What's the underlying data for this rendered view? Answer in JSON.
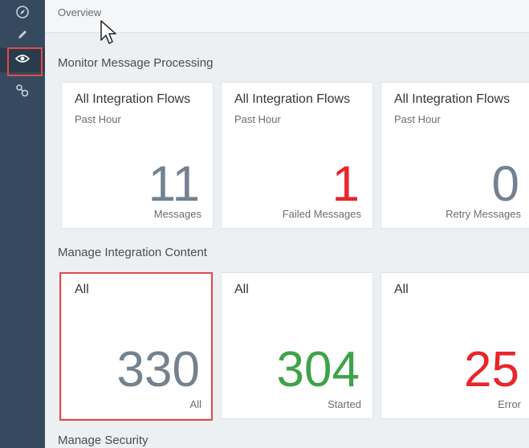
{
  "topbar": {
    "title": "Overview"
  },
  "sections": {
    "monitor": "Monitor Message Processing",
    "manage_content": "Manage Integration Content",
    "manage_security": "Manage Security"
  },
  "monitor_tiles": [
    {
      "title": "All Integration Flows",
      "subtitle": "Past Hour",
      "value": "11",
      "unit": "Messages",
      "color": "#73828e"
    },
    {
      "title": "All Integration Flows",
      "subtitle": "Past Hour",
      "value": "1",
      "unit": "Failed Messages",
      "color": "#e8262b"
    },
    {
      "title": "All Integration Flows",
      "subtitle": "Past Hour",
      "value": "0",
      "unit": "Retry Messages",
      "color": "#73828e"
    }
  ],
  "content_tiles": [
    {
      "title": "All",
      "value": "330",
      "unit": "All",
      "color": "#73828e"
    },
    {
      "title": "All",
      "value": "304",
      "unit": "Started",
      "color": "#3ea348"
    },
    {
      "title": "All",
      "value": "25",
      "unit": "Error",
      "color": "#e8262b"
    }
  ],
  "sidebar": {
    "items": [
      {
        "icon": "discover-icon"
      },
      {
        "icon": "pencil-icon"
      },
      {
        "icon": "eye-icon",
        "active": true
      },
      {
        "icon": "settings-network-icon"
      }
    ]
  },
  "colors": {
    "sidebar": "#354a5f",
    "highlight": "#e34a4a",
    "accent_green": "#3ea348",
    "accent_red": "#e8262b"
  }
}
